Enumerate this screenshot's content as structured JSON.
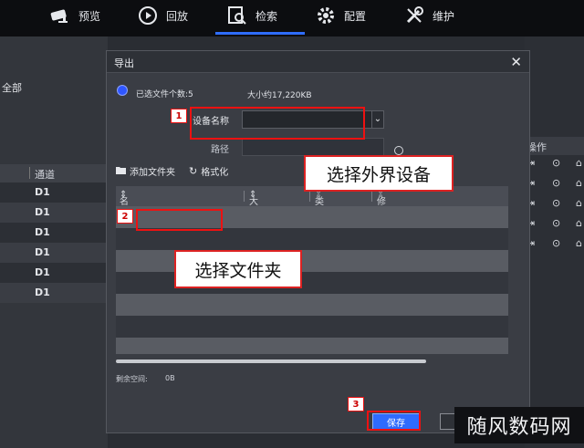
{
  "nav": {
    "items": [
      {
        "label": "预览",
        "icon": "camera-icon"
      },
      {
        "label": "回放",
        "icon": "playback-icon"
      },
      {
        "label": "检索",
        "icon": "search-icon"
      },
      {
        "label": "配置",
        "icon": "gear-icon"
      },
      {
        "label": "维护",
        "icon": "wrench-icon"
      }
    ],
    "active": "检索",
    "accent": "#2f6dff"
  },
  "left": {
    "all_label": "全部",
    "col_header": "通道",
    "rows": [
      "D1",
      "D1",
      "D1",
      "D1",
      "D1",
      "D1"
    ]
  },
  "right": {
    "col_header": "操作"
  },
  "dialog": {
    "title": "导出",
    "close": "✕",
    "selected_files": "已选文件个数:5",
    "size": "大小约17,220KB",
    "device_label": "设备名称",
    "device_value": "",
    "path_label": "路径",
    "path_value": "",
    "add_folder": "添加文件夹",
    "format": "格式化",
    "columns": {
      "name": "名称",
      "size": "大小",
      "type": "类型",
      "modified": "修改日期"
    },
    "free_space_label": "剩余空间:",
    "free_space_value": "0B",
    "save_label": "保存"
  },
  "annotations": {
    "step1": "1",
    "step2": "2",
    "step3": "3",
    "callout_device": "选择外界设备",
    "callout_folder": "选择文件夹",
    "highlight_color": "#e11111"
  },
  "watermark": "随风数码网"
}
